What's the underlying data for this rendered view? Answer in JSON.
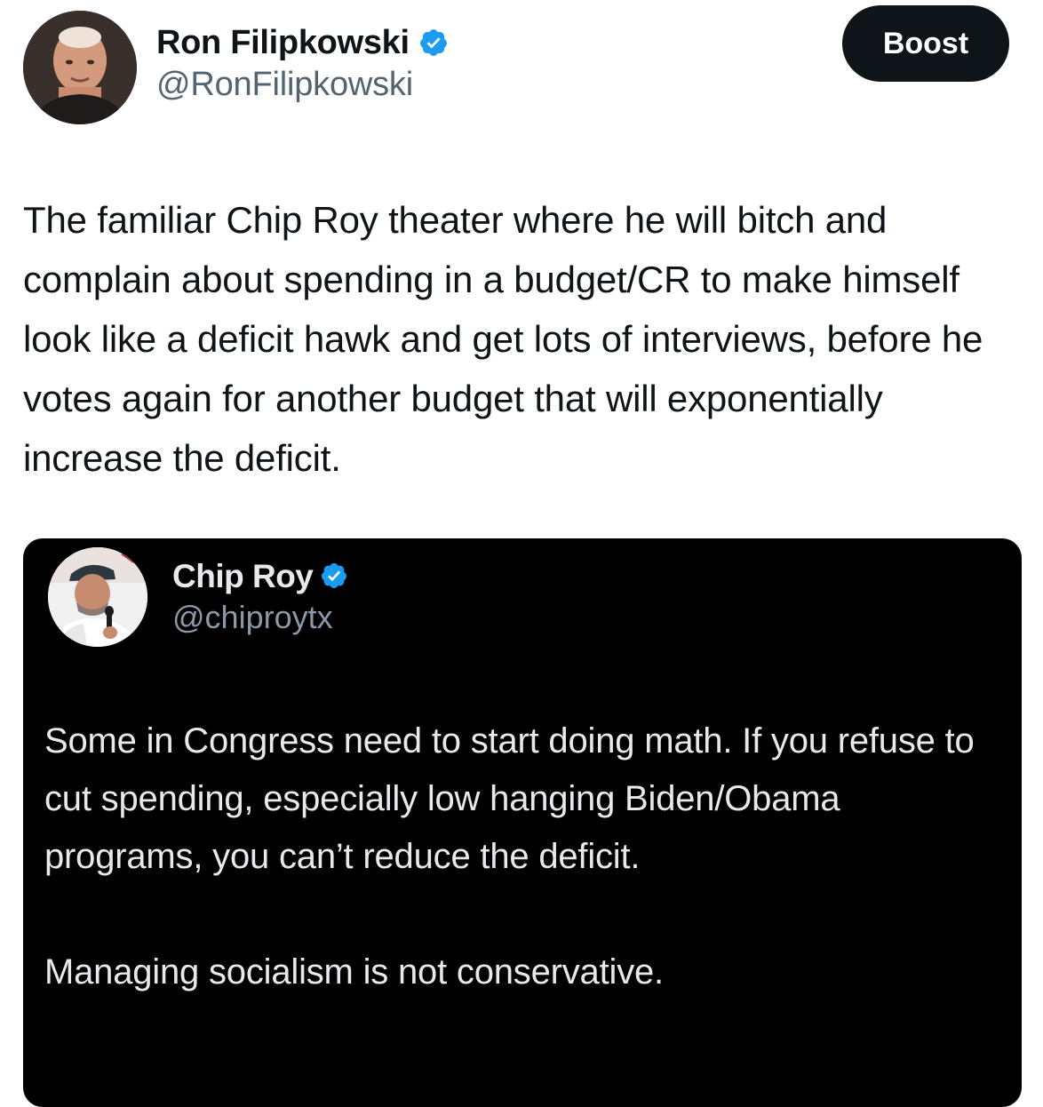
{
  "post": {
    "author_name": "Ron Filipkowski",
    "author_handle": "@RonFilipkowski",
    "boost_label": "Boost",
    "text": "The familiar Chip Roy theater where he will bitch and complain about spending in a budget/CR to make himself look like a deficit hawk and get lots of interviews, before he votes again for another budget that will exponentially increase the deficit."
  },
  "quoted_post": {
    "author_name": "Chip Roy",
    "author_handle": "@chiproytx",
    "paragraph_1": "Some in Congress need to start doing math. If you refuse to cut spending, especially low hanging Biden/Obama programs, you can’t reduce the deficit.",
    "paragraph_2": "Managing socialism is not conservative."
  },
  "colors": {
    "verified_blue": "#1d9bf0",
    "boost_bg": "#0f1419",
    "quote_bg": "#000000"
  },
  "icons": {
    "verified": "verified-badge-icon"
  }
}
